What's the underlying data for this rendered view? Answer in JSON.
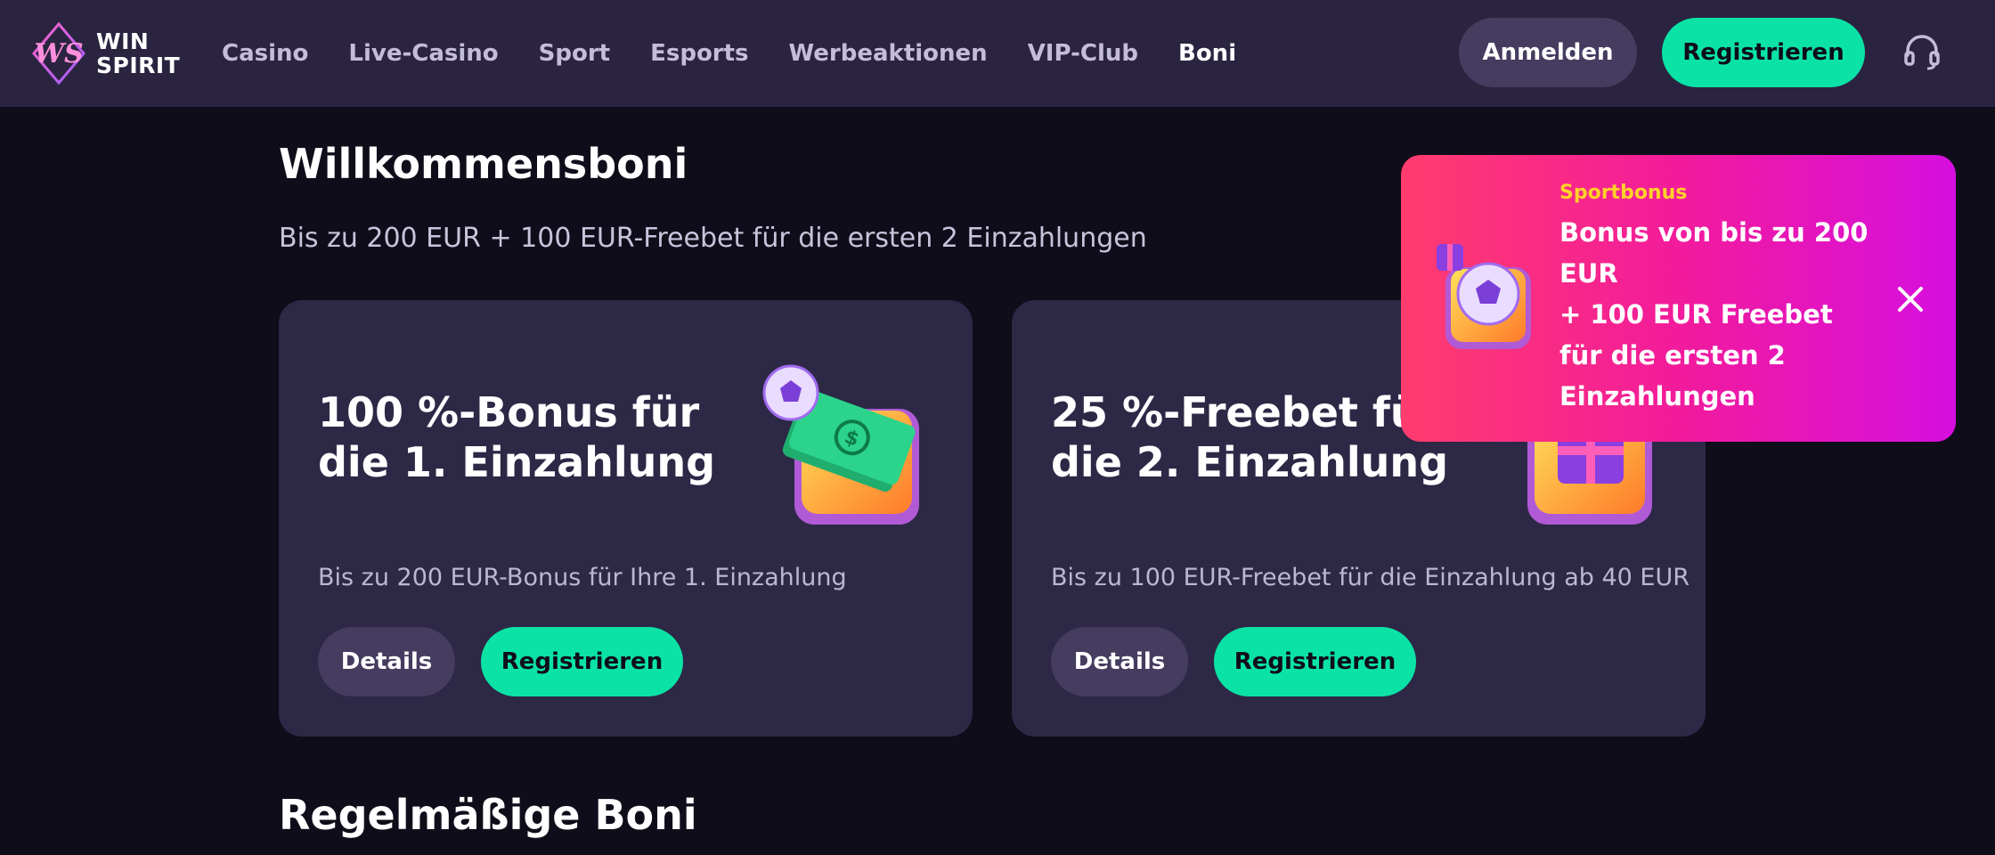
{
  "brand": {
    "logo_lines": [
      "WIN",
      "SPIRIT"
    ]
  },
  "nav": {
    "items": [
      {
        "label": "Casino"
      },
      {
        "label": "Live-Casino"
      },
      {
        "label": "Sport"
      },
      {
        "label": "Esports"
      },
      {
        "label": "Werbeaktionen"
      },
      {
        "label": "VIP-Club"
      },
      {
        "label": "Boni"
      }
    ],
    "active": "Boni"
  },
  "header": {
    "login_label": "Anmelden",
    "register_label": "Registrieren",
    "support_icon": "headset-icon"
  },
  "welcome": {
    "title": "Willkommensboni",
    "subtitle": "Bis zu 200 EUR + 100 EUR-Freebet für die ersten 2 Einzahlungen"
  },
  "cards": [
    {
      "title_lines": [
        "100 %-Bonus für",
        "die 1. Einzahlung"
      ],
      "description": "Bis zu 200 EUR-Bonus für Ihre 1. Einzahlung",
      "details_label": "Details",
      "register_label": "Registrieren",
      "art_icon": "money-ball-icon"
    },
    {
      "title_lines": [
        "25 %-Freebet für",
        "die 2. Einzahlung"
      ],
      "description": "Bis zu 100 EUR-Freebet für die Einzahlung ab 40 EUR",
      "details_label": "Details",
      "register_label": "Registrieren",
      "art_icon": "gift-box-icon"
    }
  ],
  "regular": {
    "title": "Regelmäßige Boni"
  },
  "toast": {
    "kicker": "Sportbonus",
    "body_lines": [
      "Bonus von bis zu 200",
      "EUR",
      "+ 100 EUR Freebet",
      "für die ersten 2",
      "Einzahlungen"
    ],
    "close_icon": "close-icon"
  },
  "colors": {
    "accent_green": "#0be3a6",
    "header_bg": "#2a2440",
    "page_bg": "#0f0d1a",
    "card_bg": "#2d2846",
    "toast_gradient_start": "#ff3c6e",
    "toast_gradient_end": "#d60fe0",
    "kicker_yellow": "#ffd12a"
  }
}
